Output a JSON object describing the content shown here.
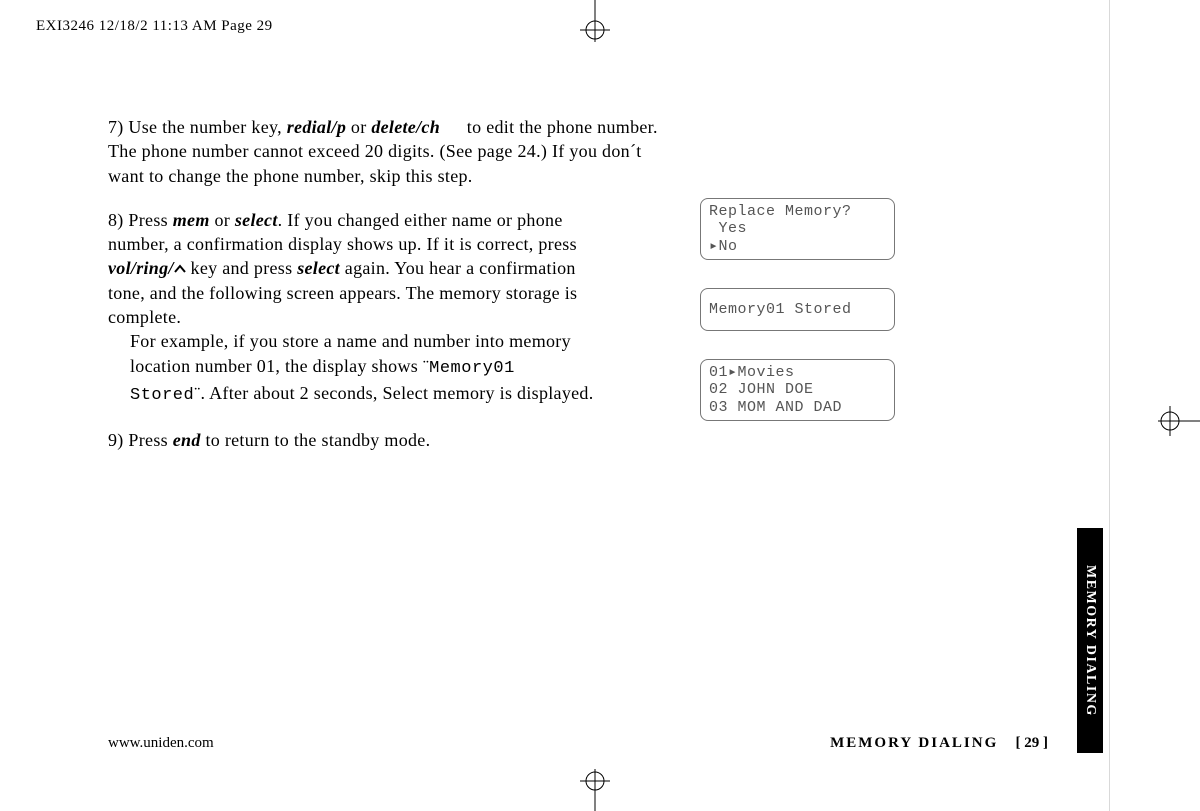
{
  "header": "EXI3246  12/18/2  11:13 AM  Page 29",
  "steps": {
    "s7": {
      "num": "7)",
      "t1": "Use the number key, ",
      "k1": "redial/p",
      "t2": " or ",
      "k2": "delete/ch",
      "t3": " to edit the phone number. The phone number cannot exceed 20 digits. (See page 24.) If you don´t want to change the phone number, skip this step."
    },
    "s8": {
      "num": "8)",
      "t1": "Press ",
      "k1": "mem",
      "t2": " or ",
      "k2": "select",
      "t3": ". If you changed either name or phone number, a confirmation display shows up. If it is correct, press ",
      "k3": "vol/ring/",
      "t4": " key and press ",
      "k4": "select",
      "t5": " again. You hear a confirmation tone, and the following screen appears. The memory storage is complete.",
      "t6": "For example, if you store a name and number into memory location number 01, the display shows ¨",
      "lcd": "Memory01 Stored",
      "t7": "¨. After about 2 seconds, Select memory is displayed."
    },
    "s9": {
      "num": "9)",
      "t1": "Press ",
      "k1": "end",
      "t2": " to return to the standby mode."
    }
  },
  "lcd_panels": {
    "p1": "Replace Memory?\n Yes\n▸No",
    "p2": "Memory01 Stored",
    "p3": "01▸Movies\n02 JOHN DOE\n03 MOM AND DAD"
  },
  "footer": {
    "left": "www.uniden.com",
    "right_label": "MEMORY DIALING",
    "page": "[ 29 ]"
  },
  "side_tab": "MEMORY DIALING"
}
